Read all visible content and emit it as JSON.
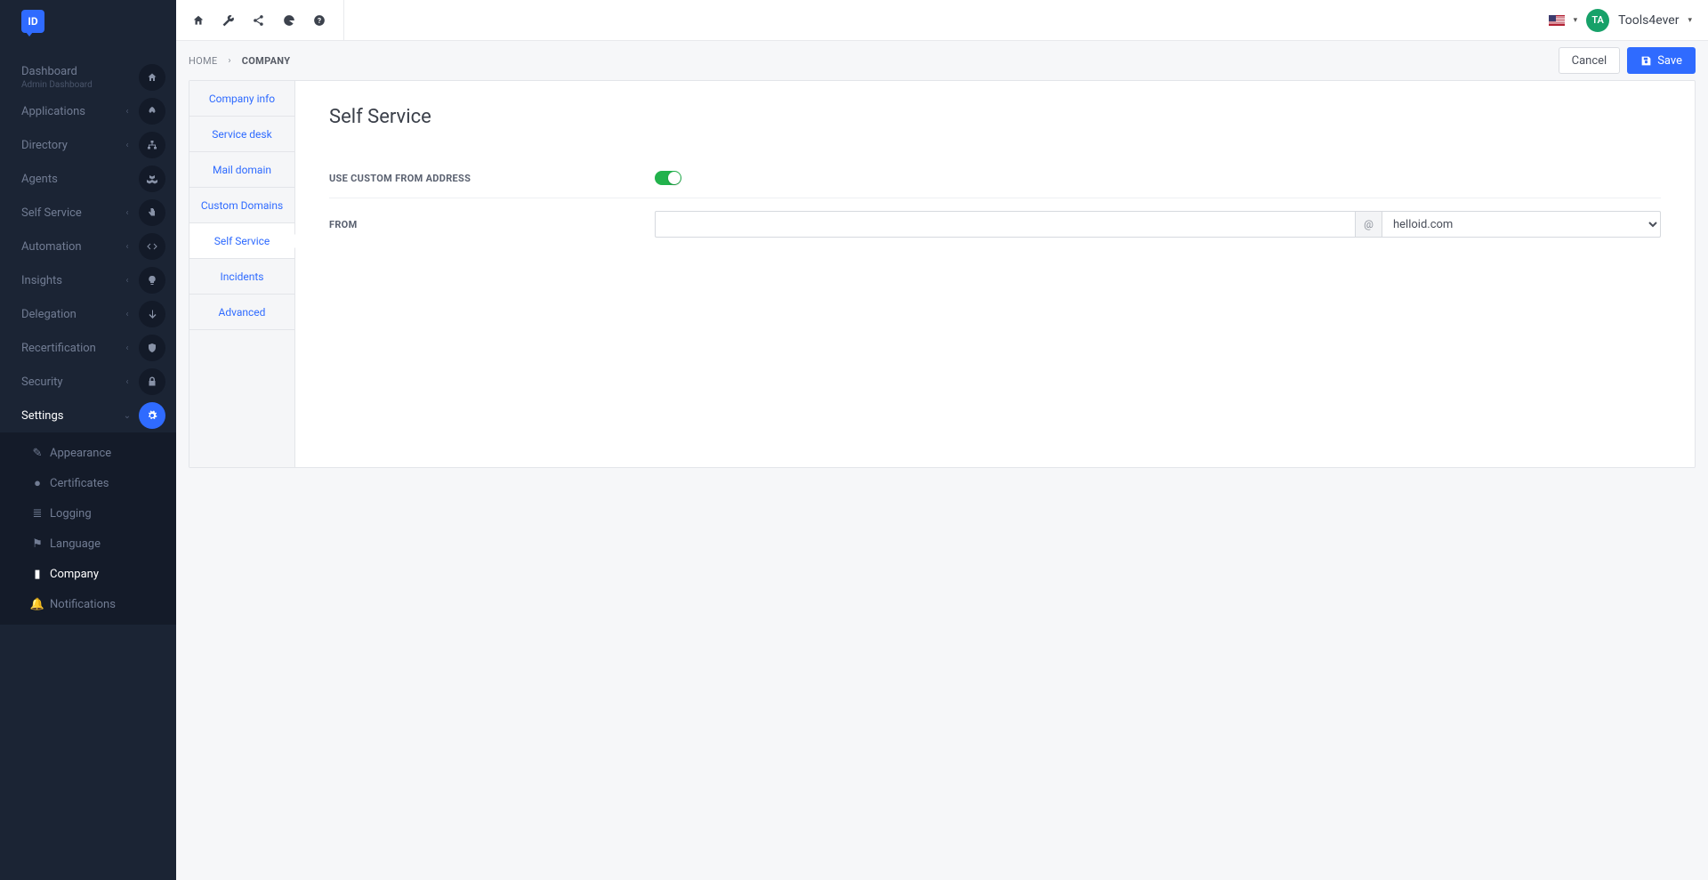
{
  "logo_text": "ID",
  "sidebar": {
    "items": [
      {
        "label": "Dashboard",
        "subtitle": "Admin Dashboard",
        "icon": "house"
      },
      {
        "label": "Applications",
        "icon": "rocket",
        "expandable": true
      },
      {
        "label": "Directory",
        "icon": "sitemap",
        "expandable": true
      },
      {
        "label": "Agents",
        "icon": "cubes"
      },
      {
        "label": "Self Service",
        "icon": "hand",
        "expandable": true
      },
      {
        "label": "Automation",
        "icon": "codebraces",
        "expandable": true
      },
      {
        "label": "Insights",
        "icon": "bulb",
        "expandable": true
      },
      {
        "label": "Delegation",
        "icon": "arrowdown",
        "expandable": true
      },
      {
        "label": "Recertification",
        "icon": "shield",
        "expandable": true
      },
      {
        "label": "Security",
        "icon": "lock",
        "expandable": true
      },
      {
        "label": "Settings",
        "icon": "gear",
        "expandable": true,
        "open": true
      }
    ],
    "settings_sub": [
      {
        "label": "Appearance",
        "icon": "brush"
      },
      {
        "label": "Certificates",
        "icon": "dot"
      },
      {
        "label": "Logging",
        "icon": "list"
      },
      {
        "label": "Language",
        "icon": "lang"
      },
      {
        "label": "Company",
        "icon": "building",
        "active": true
      },
      {
        "label": "Notifications",
        "icon": "bell"
      }
    ]
  },
  "topbar": {
    "username": "Tools4ever",
    "avatar_initials": "TA"
  },
  "breadcrumb": {
    "home": "HOME",
    "current": "COMPANY"
  },
  "actions": {
    "cancel": "Cancel",
    "save": "Save"
  },
  "tabs": [
    "Company info",
    "Service desk",
    "Mail domain",
    "Custom Domains",
    "Self Service",
    "Incidents",
    "Advanced"
  ],
  "active_tab_index": 4,
  "pane": {
    "title": "Self Service",
    "use_custom_label": "USE CUSTOM FROM ADDRESS",
    "from_label": "FROM",
    "from_value": "",
    "domain_selected": "helloid.com"
  }
}
